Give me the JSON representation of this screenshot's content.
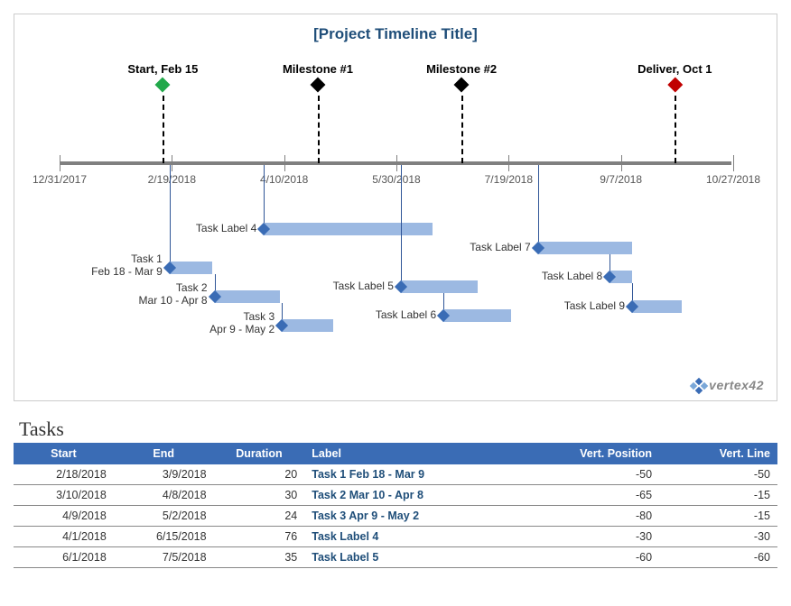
{
  "chart_data": {
    "type": "timeline",
    "title": "[Project Timeline Title]",
    "x_axis": {
      "min": "12/31/2017",
      "max": "10/27/2018",
      "ticks": [
        "12/31/2017",
        "2/19/2018",
        "4/10/2018",
        "5/30/2018",
        "7/19/2018",
        "9/7/2018",
        "10/27/2018"
      ]
    },
    "milestones": [
      {
        "label": "Start, Feb 15",
        "date": "2/15/2018",
        "color": "#21a84a"
      },
      {
        "label": "Milestone #1",
        "date": "4/25/2018",
        "color": "#000000"
      },
      {
        "label": "Milestone #2",
        "date": "6/28/2018",
        "color": "#000000"
      },
      {
        "label": "Deliver, Oct 1",
        "date": "10/1/2018",
        "color": "#c00000"
      }
    ],
    "tasks": [
      {
        "start": "2/18/2018",
        "end": "3/9/2018",
        "label_l1": "Task 1",
        "label_l2": "Feb 18 - Mar 9",
        "vpos": -50,
        "vline": -50
      },
      {
        "start": "3/10/2018",
        "end": "4/8/2018",
        "label_l1": "Task 2",
        "label_l2": "Mar 10 - Apr 8",
        "vpos": -65,
        "vline": -15
      },
      {
        "start": "4/9/2018",
        "end": "5/2/2018",
        "label_l1": "Task 3",
        "label_l2": "Apr 9 - May 2",
        "vpos": -80,
        "vline": -15
      },
      {
        "start": "4/1/2018",
        "end": "6/15/2018",
        "label_l1": "Task Label 4",
        "label_l2": "",
        "vpos": -30,
        "vline": -30
      },
      {
        "start": "6/1/2018",
        "end": "7/5/2018",
        "label_l1": "Task Label 5",
        "label_l2": "",
        "vpos": -60,
        "vline": -60
      },
      {
        "start": "6/20/2018",
        "end": "7/20/2018",
        "label_l1": "Task Label 6",
        "label_l2": "",
        "vpos": -75,
        "vline": -15
      },
      {
        "start": "8/1/2018",
        "end": "9/12/2018",
        "label_l1": "Task Label 7",
        "label_l2": "",
        "vpos": -40,
        "vline": -40
      },
      {
        "start": "9/2/2018",
        "end": "9/12/2018",
        "label_l1": "Task Label 8",
        "label_l2": "",
        "vpos": -55,
        "vline": -15
      },
      {
        "start": "9/12/2018",
        "end": "10/4/2018",
        "label_l1": "Task Label 9",
        "label_l2": "",
        "vpos": -70,
        "vline": -15
      }
    ]
  },
  "table": {
    "title": "Tasks",
    "headers": {
      "start": "Start",
      "end": "End",
      "duration": "Duration",
      "label": "Label",
      "vpos": "Vert. Position",
      "vline": "Vert. Line"
    },
    "rows": [
      {
        "start": "2/18/2018",
        "end": "3/9/2018",
        "duration": "20",
        "label": "Task 1  Feb 18 - Mar 9",
        "vpos": "-50",
        "vline": "-50"
      },
      {
        "start": "3/10/2018",
        "end": "4/8/2018",
        "duration": "30",
        "label": "Task 2  Mar 10 - Apr 8",
        "vpos": "-65",
        "vline": "-15"
      },
      {
        "start": "4/9/2018",
        "end": "5/2/2018",
        "duration": "24",
        "label": "Task 3  Apr 9 - May 2",
        "vpos": "-80",
        "vline": "-15"
      },
      {
        "start": "4/1/2018",
        "end": "6/15/2018",
        "duration": "76",
        "label": "Task Label 4",
        "vpos": "-30",
        "vline": "-30"
      },
      {
        "start": "6/1/2018",
        "end": "7/5/2018",
        "duration": "35",
        "label": "Task Label 5",
        "vpos": "-60",
        "vline": "-60"
      }
    ]
  },
  "logo": {
    "text": "vertex42"
  }
}
